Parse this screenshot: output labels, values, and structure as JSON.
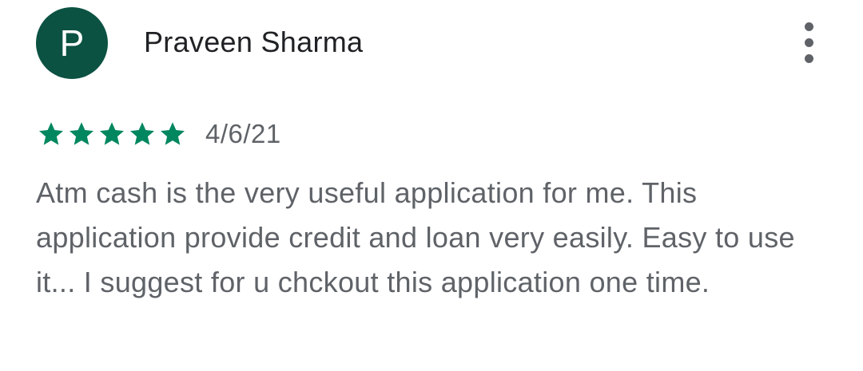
{
  "review": {
    "avatar_initial": "P",
    "reviewer_name": "Praveen Sharma",
    "more_icon": "more-vert-icon",
    "rating": 5,
    "rating_max": 5,
    "star_color": "#01875f",
    "avatar_color": "#0c5243",
    "date": "4/6/21",
    "text": "Atm cash is the very useful application for me. This application provide credit and loan very easily. Easy to use it... I suggest for u chckout this application one time."
  }
}
